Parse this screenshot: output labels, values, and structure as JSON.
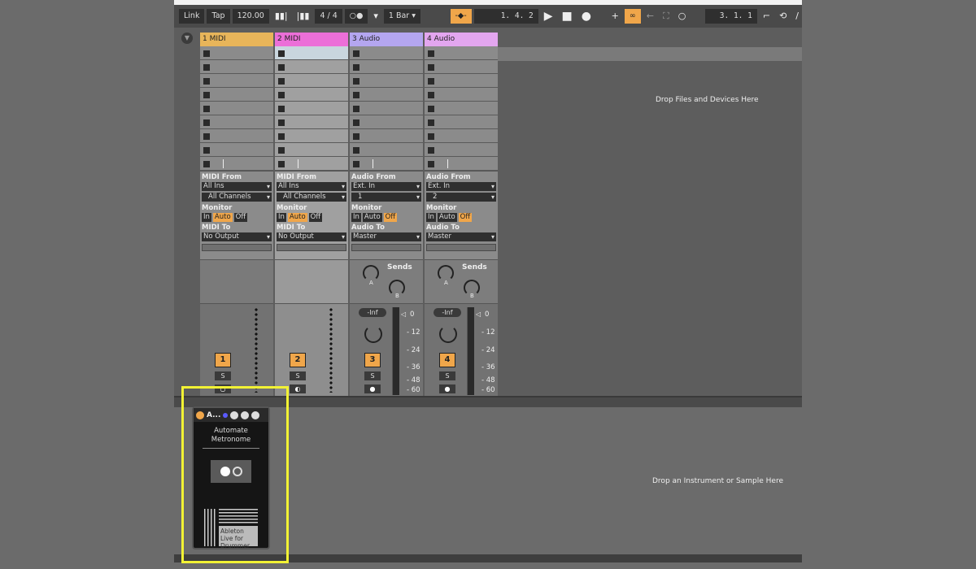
{
  "toolbar": {
    "link": "Link",
    "tap": "Tap",
    "tempo": "120.00",
    "signature": "4 / 4",
    "metronome": "○●",
    "quantize": "1 Bar",
    "position": "1.   4.   2",
    "loop_start": "3.   1.   1"
  },
  "tracks": [
    {
      "name": "1 MIDI",
      "color": "#e8b55a",
      "type": "midi",
      "from_label": "MIDI From",
      "from": "All Ins",
      "channel": "All Channels",
      "monitor_label": "Monitor",
      "monitor": [
        "In",
        "Auto",
        "Off"
      ],
      "monitor_active": "Auto",
      "to_label": "MIDI To",
      "to": "No Output",
      "number": "1",
      "solo": "S",
      "arm": "○",
      "bg": "#8b8b8b"
    },
    {
      "name": "2 MIDI",
      "color": "#ec6fd8",
      "type": "midi",
      "from_label": "MIDI From",
      "from": "All Ins",
      "channel": "All Channels",
      "monitor_label": "Monitor",
      "monitor": [
        "In",
        "Auto",
        "Off"
      ],
      "monitor_active": "Auto",
      "to_label": "MIDI To",
      "to": "No Output",
      "number": "2",
      "solo": "S",
      "arm": "◐",
      "bg": "#a0a0a0"
    },
    {
      "name": "3 Audio",
      "color": "#b4a6f0",
      "type": "audio",
      "from_label": "Audio From",
      "from": "Ext. In",
      "channel": "1",
      "monitor_label": "Monitor",
      "monitor": [
        "In",
        "Auto",
        "Off"
      ],
      "monitor_active": "Off",
      "to_label": "Audio To",
      "to": "Master",
      "number": "3",
      "solo": "S",
      "arm": "●",
      "sends_label": "Sends",
      "send_a": "A",
      "send_b": "B",
      "volume": "-Inf",
      "scale": [
        "0",
        "12",
        "24",
        "36",
        "48",
        "60"
      ],
      "bg": "#8b8b8b"
    },
    {
      "name": "4 Audio",
      "color": "#e3a6ef",
      "type": "audio",
      "from_label": "Audio From",
      "from": "Ext. In",
      "channel": "2",
      "monitor_label": "Monitor",
      "monitor": [
        "In",
        "Auto",
        "Off"
      ],
      "monitor_active": "Off",
      "to_label": "Audio To",
      "to": "Master",
      "number": "4",
      "solo": "S",
      "arm": "●",
      "sends_label": "Sends",
      "send_a": "A",
      "send_b": "B",
      "volume": "-Inf",
      "scale": [
        "0",
        "12",
        "24",
        "36",
        "48",
        "60"
      ],
      "bg": "#8b8b8b"
    }
  ],
  "hints": {
    "drop_files": "Drop Files and Devices Here",
    "drop_instrument": "Drop an Instrument or Sample Here"
  },
  "device": {
    "title": "A...",
    "heading": "Automate Metronome",
    "logo_text": "Ableton Live for Drummer"
  },
  "colors": {
    "accent": "#f0a64a",
    "highlight": "#f2f234"
  }
}
